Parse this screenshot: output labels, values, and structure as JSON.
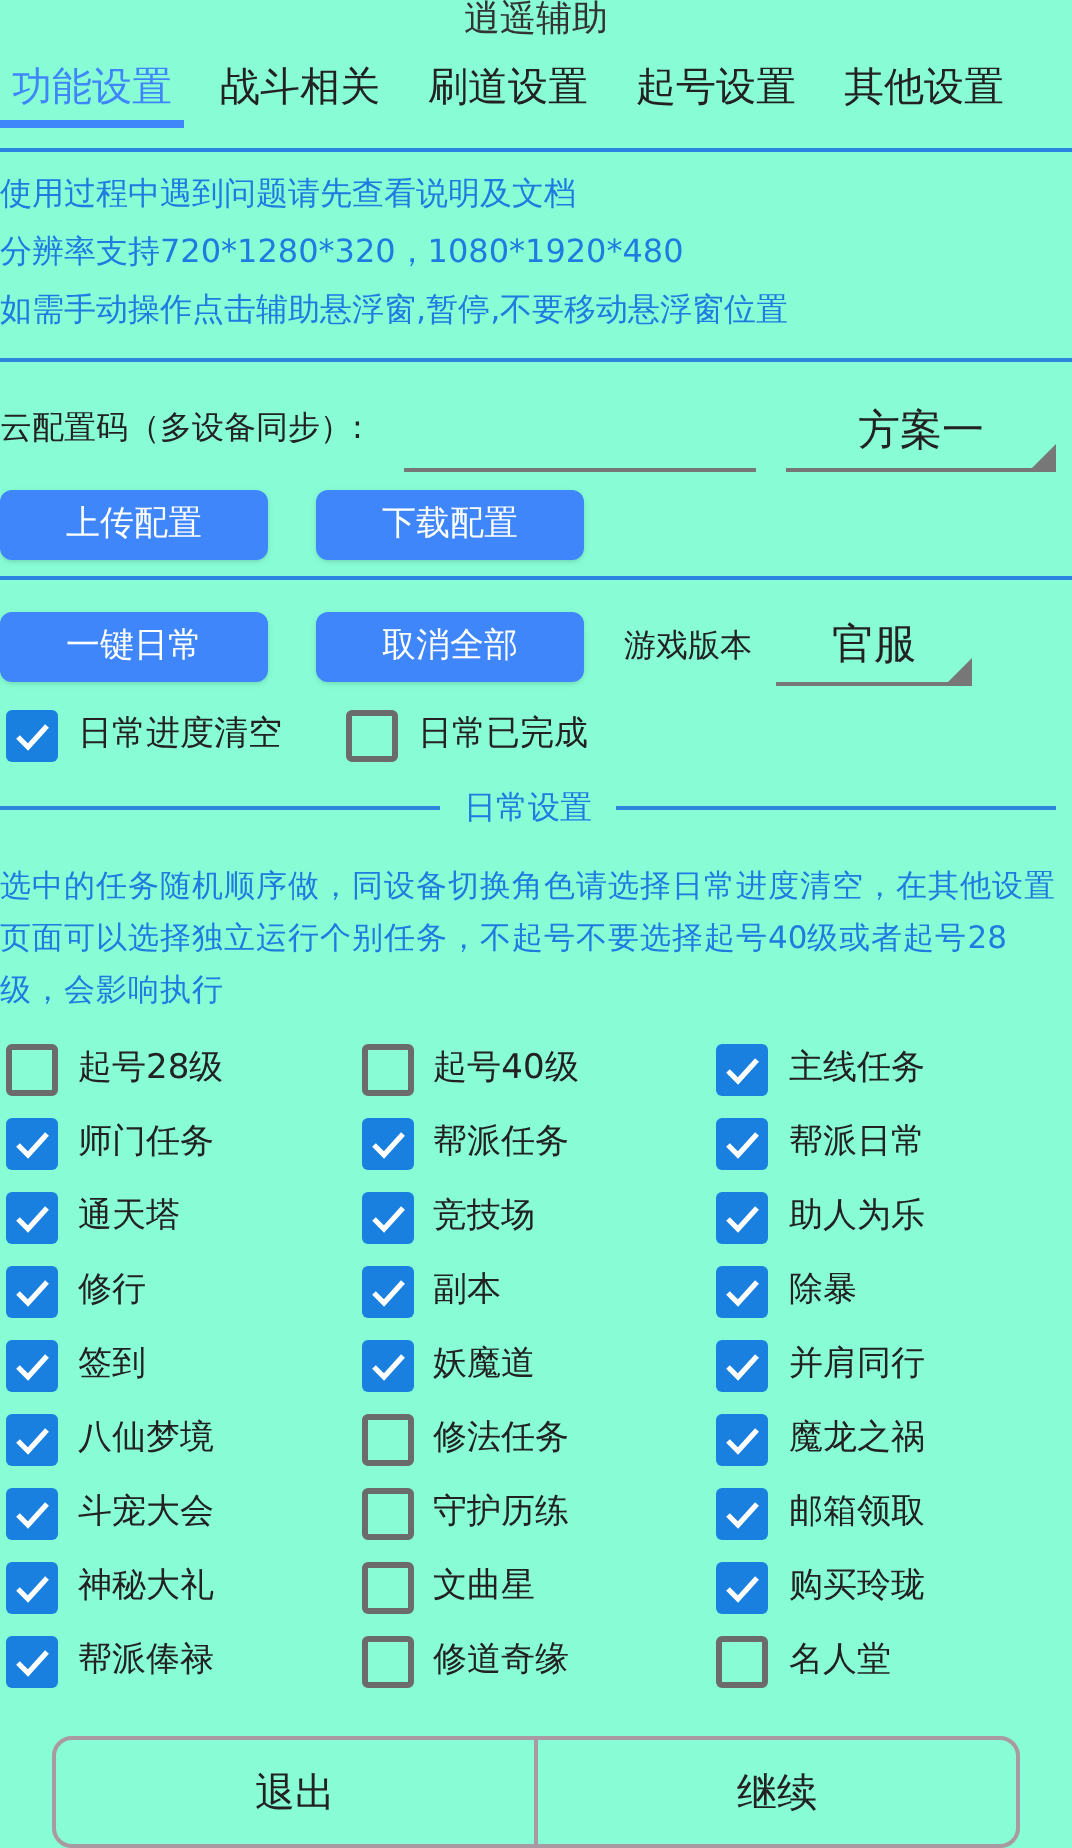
{
  "title": "逍遥辅助",
  "tabs": [
    {
      "label": "功能设置",
      "selected": true
    },
    {
      "label": "战斗相关",
      "selected": false
    },
    {
      "label": "刷道设置",
      "selected": false
    },
    {
      "label": "起号设置",
      "selected": false
    },
    {
      "label": "其他设置",
      "selected": false
    }
  ],
  "notices": [
    "使用过程中遇到问题请先查看说明及文档",
    "分辨率支持720*1280*320，1080*1920*480",
    "如需手动操作点击辅助悬浮窗,暂停,不要移动悬浮窗位置"
  ],
  "cloud_config": {
    "label": "云配置码（多设备同步）:",
    "scheme": "方案一",
    "buttons": [
      "上传配置",
      "下载配置"
    ]
  },
  "daily_actions": {
    "buttons": [
      "一键日常",
      "取消全部"
    ],
    "version_label": "游戏版本",
    "version": "官服"
  },
  "progress_options": [
    {
      "label": "日常进度清空",
      "checked": true
    },
    {
      "label": "日常已完成",
      "checked": false
    }
  ],
  "section_title": "日常设置",
  "section_note": "选中的任务随机顺序做，同设备切换角色请选择日常进度清空，在其他设置页面可以选择独立运行个别任务，不起号不要选择起号40级或者起号28级，会影响执行",
  "tasks": [
    {
      "label": "起号28级",
      "checked": false
    },
    {
      "label": "起号40级",
      "checked": false
    },
    {
      "label": "主线任务",
      "checked": true
    },
    {
      "label": "师门任务",
      "checked": true
    },
    {
      "label": "帮派任务",
      "checked": true
    },
    {
      "label": "帮派日常",
      "checked": true
    },
    {
      "label": "通天塔",
      "checked": true
    },
    {
      "label": "竞技场",
      "checked": true
    },
    {
      "label": "助人为乐",
      "checked": true
    },
    {
      "label": "修行",
      "checked": true
    },
    {
      "label": "副本",
      "checked": true
    },
    {
      "label": "除暴",
      "checked": true
    },
    {
      "label": "签到",
      "checked": true
    },
    {
      "label": "妖魔道",
      "checked": true
    },
    {
      "label": "并肩同行",
      "checked": true
    },
    {
      "label": "八仙梦境",
      "checked": true
    },
    {
      "label": "修法任务",
      "checked": false
    },
    {
      "label": "魔龙之祸",
      "checked": true
    },
    {
      "label": "斗宠大会",
      "checked": true
    },
    {
      "label": "守护历练",
      "checked": false
    },
    {
      "label": "邮箱领取",
      "checked": true
    },
    {
      "label": "神秘大礼",
      "checked": true
    },
    {
      "label": "文曲星",
      "checked": false
    },
    {
      "label": "购买玲珑",
      "checked": true
    },
    {
      "label": "帮派俸禄",
      "checked": true
    },
    {
      "label": "修道奇缘",
      "checked": false
    },
    {
      "label": "名人堂",
      "checked": false
    }
  ],
  "footer_buttons": [
    "退出",
    "继续"
  ]
}
